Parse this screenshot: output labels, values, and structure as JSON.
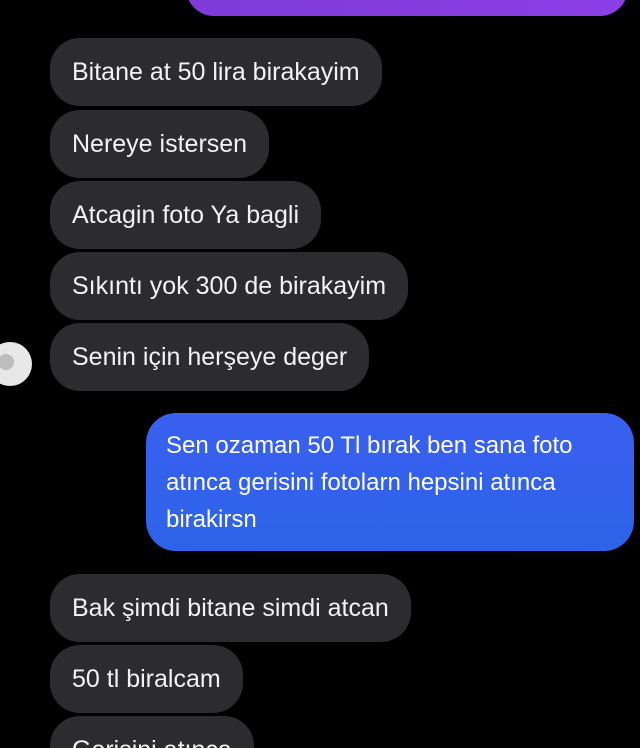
{
  "messages": {
    "m1": "Bitane at 50 lira birakayim",
    "m2": "Nereye istersen",
    "m3": "Atcagin foto Ya bagli",
    "m4": "Sıkıntı yok 300 de  birakayim",
    "m5": "Senin için herşeye deger",
    "m6": "Sen  ozaman 50 Tl bırak ben sana foto atınca gerisini fotolarn hepsini atınca birakirsn",
    "m7": "Bak şimdi bitane simdi atcan",
    "m8": "50 tl biralcam",
    "m9": "Gerisini atınca"
  },
  "colors": {
    "incoming_bubble": "#2c2c2e",
    "outgoing_bubble": "#2f5fe8",
    "top_bubble": "#8b3ee6",
    "background": "#000000"
  }
}
